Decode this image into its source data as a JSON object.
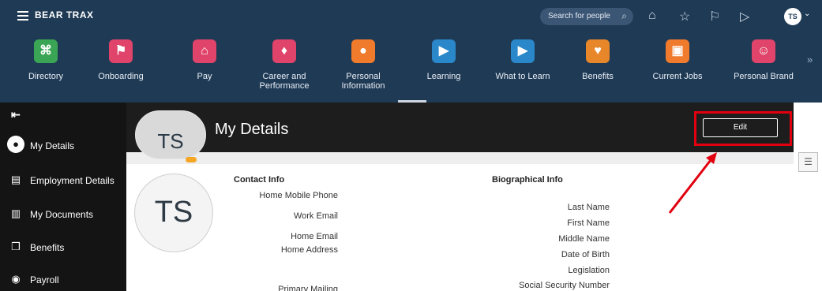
{
  "topbar": {
    "logo_text": "BEAR TRAX",
    "search_placeholder": "Search for people",
    "icons": [
      "hamburger-icon",
      "search-icon",
      "home-icon",
      "star-icon",
      "flag-icon",
      "notifications-icon"
    ],
    "user_initials": "TS"
  },
  "apps": [
    {
      "label": "Directory",
      "color": "#3aa655",
      "icon": "directory-icon",
      "glyph": "⌘"
    },
    {
      "label": "Onboarding",
      "color": "#e0446a",
      "icon": "onboarding-icon",
      "glyph": "⚑"
    },
    {
      "label": "Pay",
      "color": "#e0446a",
      "icon": "bank-icon",
      "glyph": "⌂"
    },
    {
      "label": "Career and Performance",
      "color": "#e0446a",
      "icon": "career-icon",
      "glyph": "♦"
    },
    {
      "label": "Personal Information",
      "color": "#f07b2c",
      "icon": "person-icon",
      "glyph": "●"
    },
    {
      "label": "Learning",
      "color": "#2a87c9",
      "icon": "play-icon",
      "glyph": "▶"
    },
    {
      "label": "What to Learn",
      "color": "#2a87c9",
      "icon": "play-icon",
      "glyph": "▶"
    },
    {
      "label": "Benefits",
      "color": "#e8872a",
      "icon": "gift-icon",
      "glyph": "♥"
    },
    {
      "label": "Current Jobs",
      "color": "#f07b2c",
      "icon": "jobs-icon",
      "glyph": "▣"
    },
    {
      "label": "Personal Brand",
      "color": "#e0446a",
      "icon": "brand-icon",
      "glyph": "☺"
    }
  ],
  "sidebar": {
    "items": [
      {
        "label": "My Details",
        "icon": "person-icon",
        "glyph": "●"
      },
      {
        "label": "Employment Details",
        "icon": "id-badge-icon",
        "glyph": "▤"
      },
      {
        "label": "My Documents",
        "icon": "document-icon",
        "glyph": "▥"
      },
      {
        "label": "Benefits",
        "icon": "gift-icon",
        "glyph": "❒"
      },
      {
        "label": "Payroll",
        "icon": "payroll-icon",
        "glyph": "◉"
      }
    ]
  },
  "header": {
    "avatar_initials": "TS",
    "page_title": "My Details",
    "edit_label": "Edit"
  },
  "profile": {
    "avatar_initials": "TS"
  },
  "contact": {
    "title": "Contact Info",
    "fields": [
      "Home Mobile Phone",
      "Work Email",
      "Home Email",
      "Home Address",
      "Primary Mailing"
    ]
  },
  "bio": {
    "title": "Biographical Info",
    "fields": [
      "Last Name",
      "First Name",
      "Middle Name",
      "Date of Birth",
      "Legislation",
      "Social Security Number"
    ]
  },
  "colors": {
    "topbar_bg": "#1f3a55",
    "sidebar_bg": "#141414",
    "highlight": "#e0000e"
  }
}
